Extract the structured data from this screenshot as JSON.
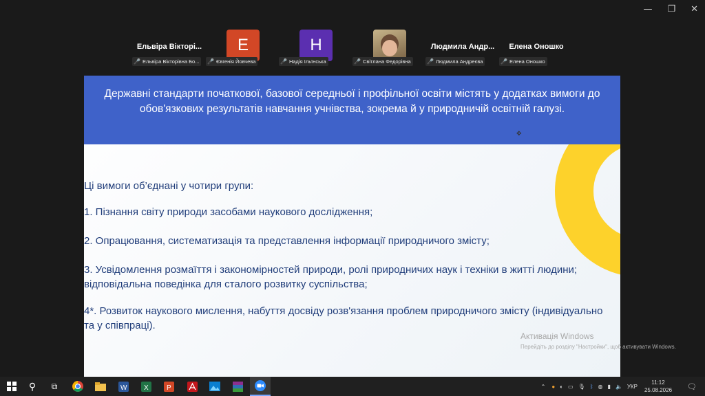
{
  "window_controls": {
    "minimize": "—",
    "restore": "❐",
    "close": "✕"
  },
  "participants": [
    {
      "display_name": "Ельвіра Вікторі...",
      "label": "Ельвіра Вікторівна Бо...",
      "avatar": ""
    },
    {
      "display_name": "",
      "label": "Євгенія Йовчева",
      "avatar": "E",
      "avatar_color": "#d24726"
    },
    {
      "display_name": "",
      "label": "Надія Ільїнська",
      "avatar": "H",
      "avatar_color": "#5b2fb0"
    },
    {
      "display_name": "",
      "label": "Світлана Федорівна",
      "avatar": "photo"
    },
    {
      "display_name": "Людмила  Андр...",
      "label": "Людмила Андреєва",
      "avatar": ""
    },
    {
      "display_name": "Елена Оношко",
      "label": "Елена Оношко",
      "avatar": ""
    }
  ],
  "slide": {
    "header_text": "Державні стандарти початкової, базової середньої і профільної освіти містять у додатках вимоги до обов'язкових результатів навчання учнівства, зокрема й у природничій освітній галузі.",
    "intro": " Ці вимоги об’єднані у чотири групи:",
    "items": [
      " 1. Пізнання світу природи засобами наукового дослідження;",
      " 2. Опрацювання, систематизація та представлення інформації природничого змісту;",
      "3. Усвідомлення розмаїття і закономірностей природи, ролі природничих наук і техніки в житті людини; відповідальна поведінка для сталого розвитку суспільства;",
      "4*. Розвиток наукового мислення, набуття досвіду розв'язання проблем природничого змісту (індивідуально та у співпраці)."
    ]
  },
  "activation": {
    "title": "Активація Windows",
    "subtitle": "Перейдіть до розділу \"Настройки\", щоб активувати Windows."
  },
  "taskbar": {
    "language": "УКР",
    "time": "11:12",
    "date": "25.08.2026"
  },
  "colors": {
    "header_blue": "#3f62c9",
    "ring_yellow": "#fdd22b",
    "body_text": "#203d7a"
  }
}
